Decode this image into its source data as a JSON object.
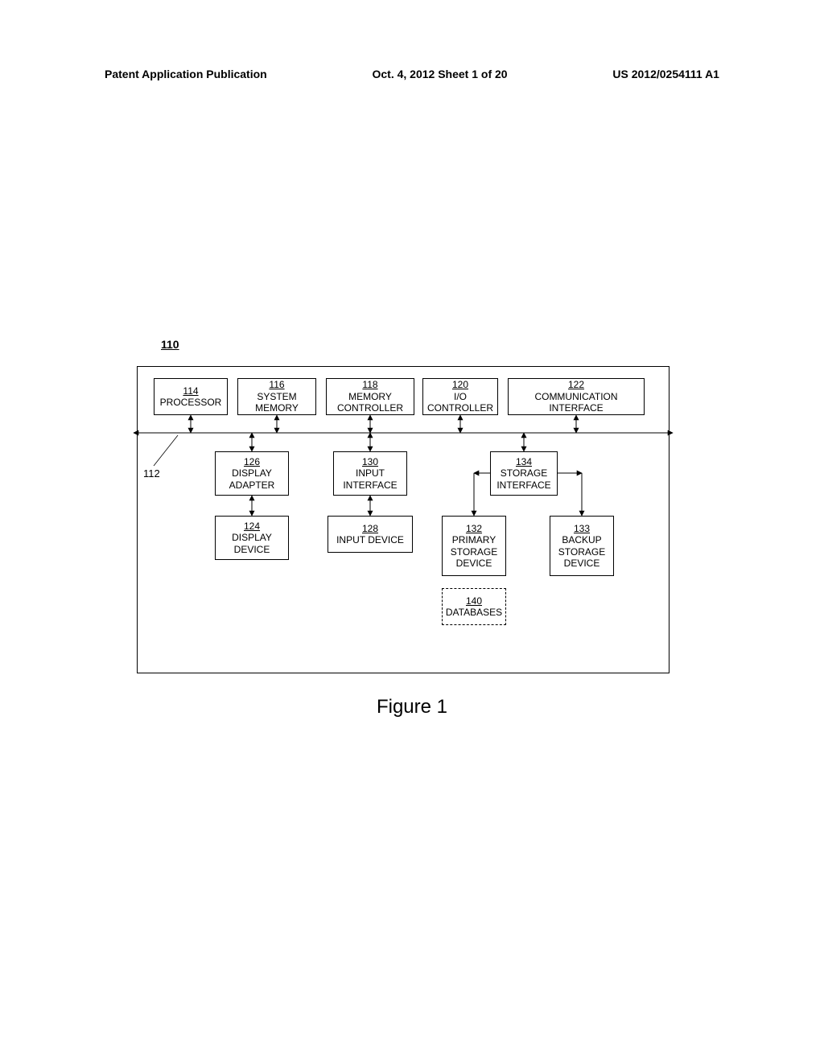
{
  "header": {
    "left": "Patent Application Publication",
    "center": "Oct. 4, 2012   Sheet 1 of 20",
    "right": "US 2012/0254111 A1"
  },
  "diagram": {
    "system_ref": "110",
    "bus_ref": "112",
    "figure_title": "Figure 1",
    "blocks": {
      "processor": {
        "num": "114",
        "label": "PROCESSOR"
      },
      "system_memory": {
        "num": "116",
        "label": "SYSTEM MEMORY"
      },
      "mem_controller": {
        "num": "118",
        "label": "MEMORY CONTROLLER"
      },
      "io_controller": {
        "num": "120",
        "label": "I/O CONTROLLER"
      },
      "comm_interface": {
        "num": "122",
        "label": "COMMUNICATION INTERFACE"
      },
      "display_adapter": {
        "num": "126",
        "label": "DISPLAY ADAPTER"
      },
      "input_interface": {
        "num": "130",
        "label": "INPUT INTERFACE"
      },
      "storage_interface": {
        "num": "134",
        "label": "STORAGE INTERFACE"
      },
      "display_device": {
        "num": "124",
        "label": "DISPLAY DEVICE"
      },
      "input_device": {
        "num": "128",
        "label": "INPUT DEVICE"
      },
      "primary_storage": {
        "num": "132",
        "label": "PRIMARY STORAGE DEVICE"
      },
      "backup_storage": {
        "num": "133",
        "label": "BACKUP STORAGE DEVICE"
      },
      "databases": {
        "num": "140",
        "label": "DATABASES"
      }
    }
  }
}
